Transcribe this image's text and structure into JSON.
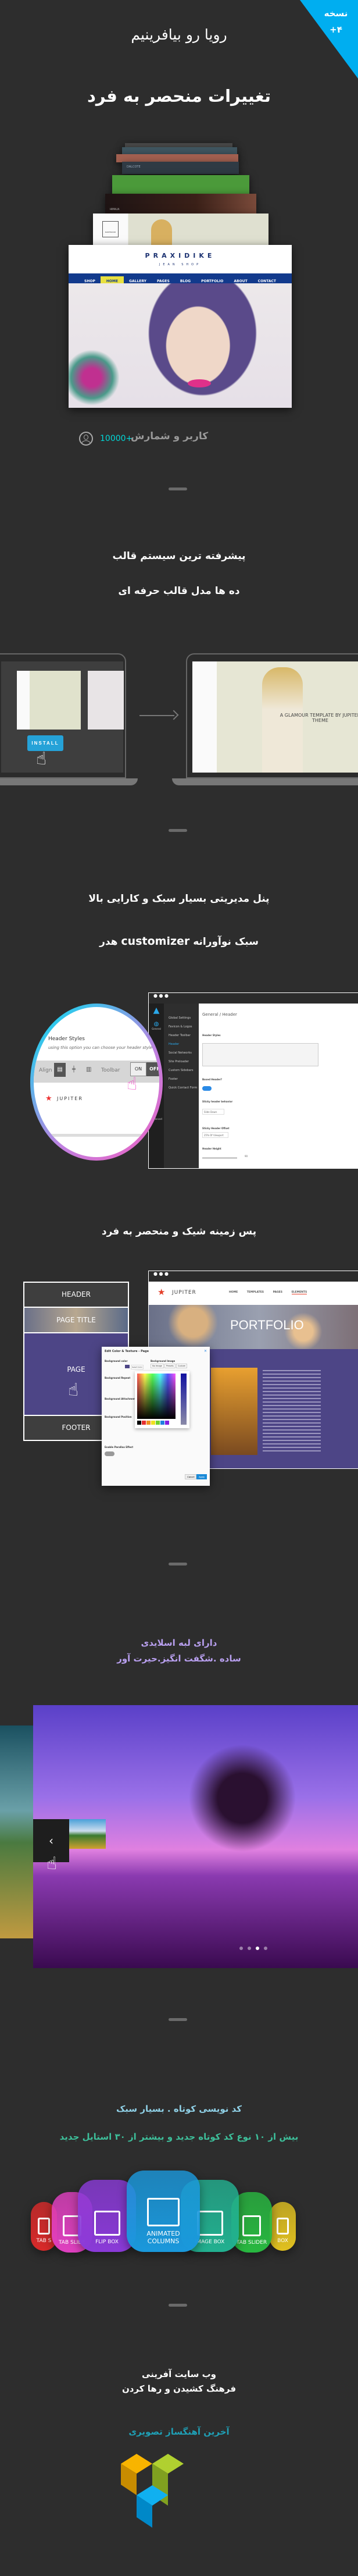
{
  "badge": {
    "label": "نسخه",
    "version": "۴+",
    "color": "#00aef0"
  },
  "hero": {
    "subtitle": "رویا رو بیافرینیم",
    "title": "تغییرات منحصر به فرد"
  },
  "showcase": {
    "brand": "PRAXIDIKE",
    "tagline": "JEAN SHOP",
    "nav": [
      "SHOP",
      "HOME",
      "GALLERY",
      "PAGES",
      "BLOG",
      "PORTFOLIO",
      "ABOUT",
      "CONTACT"
    ],
    "active_nav": "HOME",
    "stack": [
      "DALCOTE",
      "",
      "HIMALIA",
      "DANTWOOD"
    ]
  },
  "users": {
    "count": "10000+",
    "label": "کاربر و شمارش",
    "icon": "user-circle-icon",
    "count_color": "#00d8d8"
  },
  "templates": {
    "title": "پیشرفته ترین سیستم قالب",
    "subtitle": "ده ها مدل قالب حرفه ای",
    "install_label": "INSTALL",
    "preview_heading": "A GLAMOUR TEMPLATE BY JUPITER THEME"
  },
  "admin": {
    "title": "پنل مدیریتی بسیار سبک و کارایی بالا",
    "subtitle_pre": "سبک نوآورانه",
    "subtitle_word": "customizer",
    "subtitle_post": "هدر",
    "zoom": {
      "heading": "Header Styles",
      "desc": "using this option you can choose your header style",
      "align": "Align",
      "toolbar": "Toolbar",
      "on": "ON",
      "off": "OFF",
      "logo": "JUPITER"
    },
    "panel": {
      "breadcrumb": "General / Header",
      "side_icons": [
        "General",
        "Advanced"
      ],
      "menu": [
        "Global Settings",
        "Favicon & Logos",
        "Header Toolbar",
        "Header",
        "Social Networks",
        "Site Preloader",
        "Custom Sidebars",
        "Footer",
        "Quick Contact Form"
      ],
      "active_menu": "Header",
      "fields": [
        "Header Styles",
        "Boxed Header?",
        "Sticky header behavior",
        "Sticky Header Offset",
        "Header Height"
      ],
      "sticky_value": "Slide Down",
      "offset_value": "25% Of Viewport",
      "height_value": "90"
    }
  },
  "background": {
    "title": "پس زمینه شیک و منحصر به فرد",
    "layout": [
      "HEADER",
      "PAGE TITLE",
      "PAGE",
      "FOOTER"
    ],
    "site": {
      "logo": "JUPITER",
      "nav": [
        "HOME",
        "TEMPLATES",
        "PAGES",
        "ELEMENTS"
      ],
      "banner": "PORTFOLIO"
    },
    "dialog": {
      "title": "Edit Color & Texture - Page",
      "bg_color": "Background color",
      "select_color": "Select Color",
      "bg_repeat": "Background Repeat",
      "bg_attachment": "Background Attachment",
      "bg_position": "Background Position",
      "parallax": "Enable Parallax Effect",
      "bg_image": "Background Image",
      "image_options": [
        "No Image",
        "Presets",
        "Custom"
      ],
      "cancel": "Cancel",
      "apply": "Apply",
      "swatches": [
        "#000000",
        "#e53030",
        "#f09020",
        "#f0e020",
        "#70d030",
        "#2080e0",
        "#8020e0"
      ],
      "page_color": "#4d4586"
    }
  },
  "slider": {
    "line1": "دارای لبه اسلایدی",
    "line2": "ساده .شگفت انگیز.حیرت آور",
    "text_color": "#b9a0f0",
    "dots": 4,
    "active_dot": 3
  },
  "shortcodes": {
    "line1": "کد نویسی کوتاه . بسیار سبک",
    "line2": "بیش از ۱۰ نوع کد کوتاه جدید و بیشتر از ۳۰ استایل جدید",
    "line1_color": "#8fd0e6",
    "line2_color": "#3dbf9a",
    "cards": [
      {
        "label": "TAB S",
        "color": "#d82a2a"
      },
      {
        "label": "TAB SLIDE",
        "color": "#e040c0"
      },
      {
        "label": "FLIP BOX",
        "color": "#8a3ad8"
      },
      {
        "label": "ANIMATED COLUMNS",
        "color": "#1a98dc"
      },
      {
        "label": "IMAGE BOX",
        "color": "#22b090"
      },
      {
        "label": "TAB SLIDER",
        "color": "#28b840"
      },
      {
        "label": "BOX",
        "color": "#e0c020"
      }
    ]
  },
  "builder": {
    "line1": "وب سایت آفرینی",
    "line2": "فرهنگ کشیدن و رها کردن",
    "tagline": "آخرین آهنگساز تصویری",
    "tagline_color": "#1f9fb5"
  }
}
